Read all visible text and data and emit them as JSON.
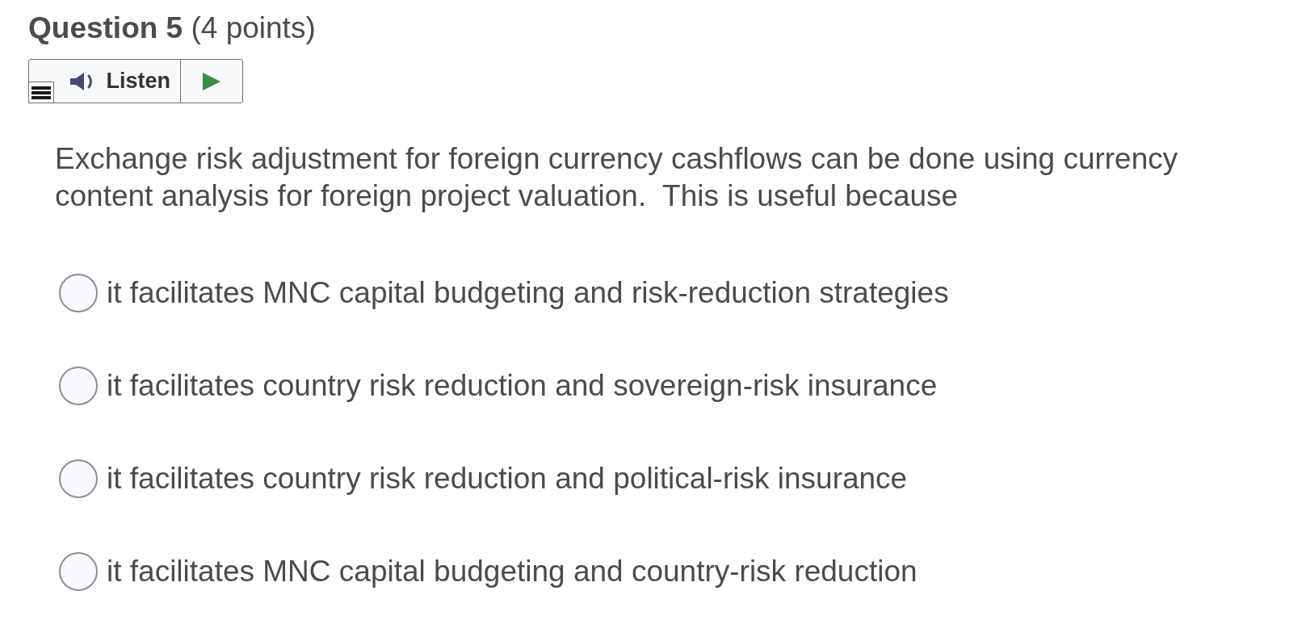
{
  "question": {
    "title": "Question 5",
    "points": "(4 points)"
  },
  "listen": {
    "label": "Listen"
  },
  "prompt": "Exchange risk adjustment for foreign currency cashflows can be done using currency content analysis for foreign project valuation.  This is useful because",
  "options": [
    {
      "text": "it facilitates MNC capital budgeting and risk-reduction strategies",
      "selected": false
    },
    {
      "text": "it facilitates country risk reduction and sovereign-risk insurance",
      "selected": false
    },
    {
      "text": "it facilitates country risk reduction and political-risk insurance",
      "selected": false
    },
    {
      "text": "it facilitates MNC capital budgeting and country-risk reduction",
      "selected": false
    }
  ]
}
